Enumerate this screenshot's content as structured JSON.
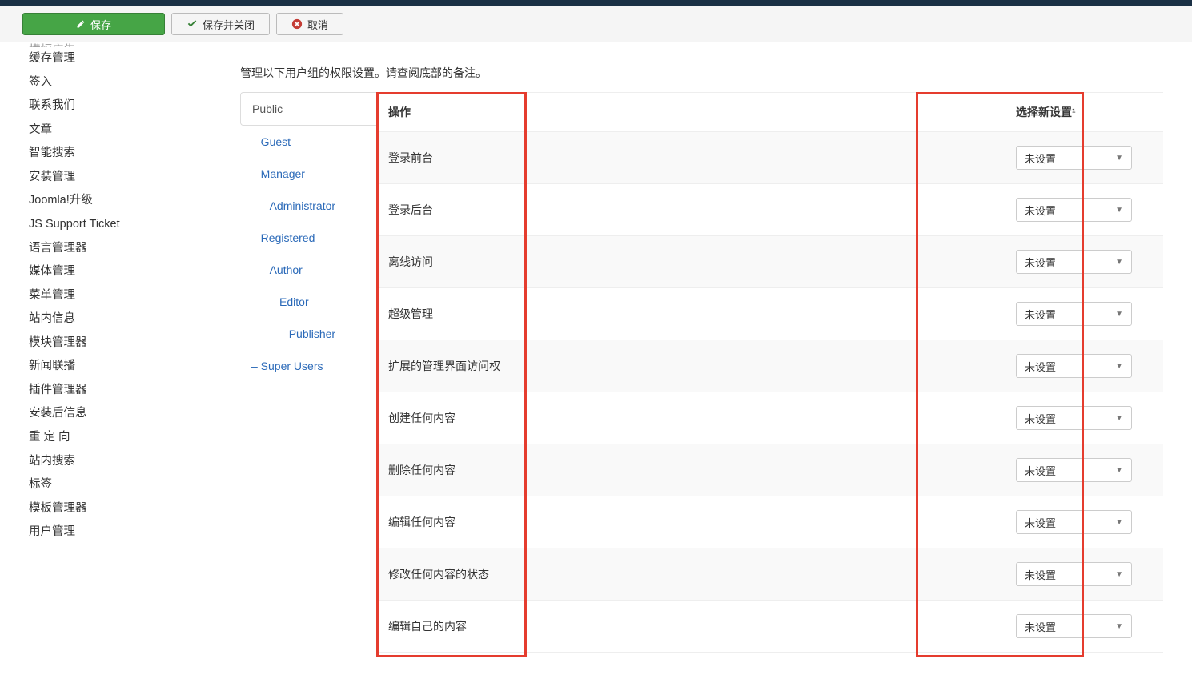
{
  "toolbar": {
    "save_label": "保存",
    "save_close_label": "保存并关闭",
    "cancel_label": "取消"
  },
  "sidebar": {
    "items": [
      "横幅广告",
      "缓存管理",
      "签入",
      "联系我们",
      "文章",
      "智能搜索",
      "安装管理",
      "Joomla!升级",
      "JS Support Ticket",
      "语言管理器",
      "媒体管理",
      "菜单管理",
      "站内信息",
      "模块管理器",
      "新闻联播",
      "插件管理器",
      "安装后信息",
      "重 定 向",
      "站内搜索",
      "标签",
      "模板管理器",
      "用户管理"
    ]
  },
  "intro": "管理以下用户组的权限设置。请查阅底部的备注。",
  "groups": [
    {
      "label": "Public",
      "indent": ""
    },
    {
      "label": "Guest",
      "indent": "– "
    },
    {
      "label": "Manager",
      "indent": "– "
    },
    {
      "label": "Administrator",
      "indent": "– – "
    },
    {
      "label": "Registered",
      "indent": "– "
    },
    {
      "label": "Author",
      "indent": "– – "
    },
    {
      "label": "Editor",
      "indent": "– – – "
    },
    {
      "label": "Publisher",
      "indent": "– – – – "
    },
    {
      "label": "Super Users",
      "indent": "– "
    }
  ],
  "table": {
    "header_action": "操作",
    "header_setting": "选择新设置¹",
    "select_value": "未设置",
    "rows": [
      "登录前台",
      "登录后台",
      "离线访问",
      "超级管理",
      "扩展的管理界面访问权",
      "创建任何内容",
      "删除任何内容",
      "编辑任何内容",
      "修改任何内容的状态",
      "编辑自己的内容"
    ]
  }
}
